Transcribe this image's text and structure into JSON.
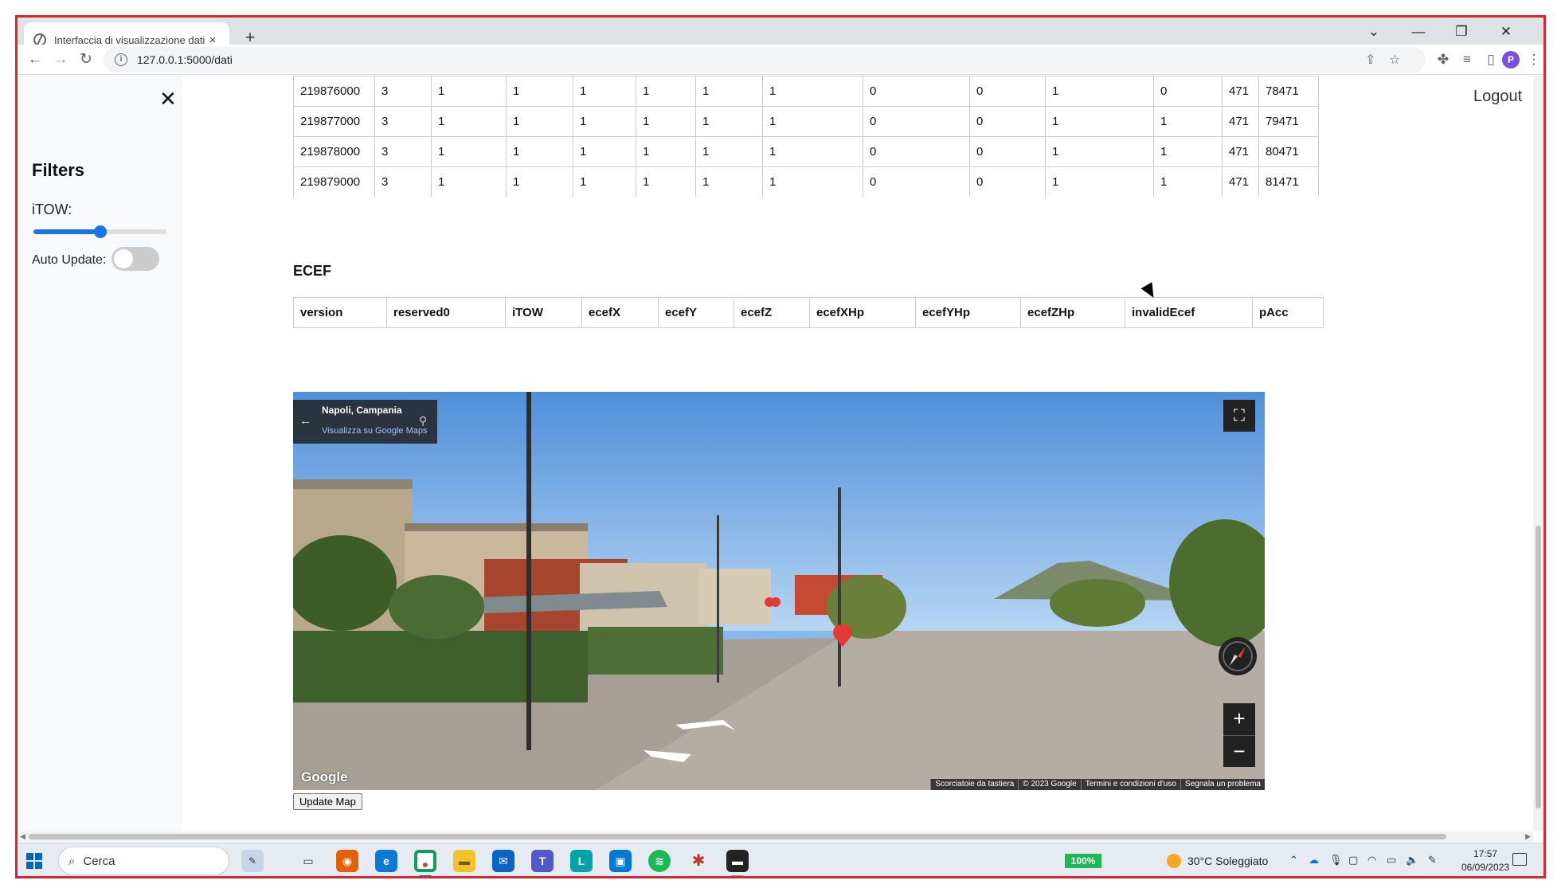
{
  "browser": {
    "tab_title": "Interfaccia di visualizzazione dati",
    "tab_close": "×",
    "new_tab": "+",
    "url": "127.0.0.1:5000/dati",
    "profile_initial": "P"
  },
  "sidebar": {
    "close": "✕",
    "title": "Filters",
    "itow_label": "iTOW:",
    "itow_slider_value": 0.5,
    "auto_update_label": "Auto Update:",
    "auto_update_on": false
  },
  "header": {
    "logout": "Logout"
  },
  "data_table": {
    "rows": [
      [
        "219876000",
        "3",
        "1",
        "1",
        "1",
        "1",
        "1",
        "1",
        "0",
        "0",
        "1",
        "0",
        "471",
        "78471"
      ],
      [
        "219877000",
        "3",
        "1",
        "1",
        "1",
        "1",
        "1",
        "1",
        "0",
        "0",
        "1",
        "1",
        "471",
        "79471"
      ],
      [
        "219878000",
        "3",
        "1",
        "1",
        "1",
        "1",
        "1",
        "1",
        "0",
        "0",
        "1",
        "1",
        "471",
        "80471"
      ],
      [
        "219879000",
        "3",
        "1",
        "1",
        "1",
        "1",
        "1",
        "1",
        "0",
        "0",
        "1",
        "1",
        "471",
        "81471"
      ]
    ]
  },
  "ecef": {
    "title": "ECEF",
    "columns": [
      "version",
      "reserved0",
      "iTOW",
      "ecefX",
      "ecefY",
      "ecefZ",
      "ecefXHp",
      "ecefYHp",
      "ecefZHp",
      "invalidEcef",
      "pAcc"
    ]
  },
  "map": {
    "location": "Napoli, Campania",
    "view_link": "Visualizza su Google Maps",
    "brand": "Google",
    "footer": [
      "Scorciatoie da tastiera",
      "© 2023 Google",
      "Termini e condizioni d'uso",
      "Segnala un problema"
    ],
    "zoom_in": "+",
    "zoom_out": "−",
    "update_button": "Update Map"
  },
  "taskbar": {
    "search": "Cerca",
    "battery": "100%",
    "weather": "30°C  Soleggiato",
    "time": "17:57",
    "date": "06/09/2023"
  },
  "colors": {
    "frame": "#d6282e",
    "slider": "#1a73e8",
    "sidebar_bg": "#f8f9fa"
  }
}
